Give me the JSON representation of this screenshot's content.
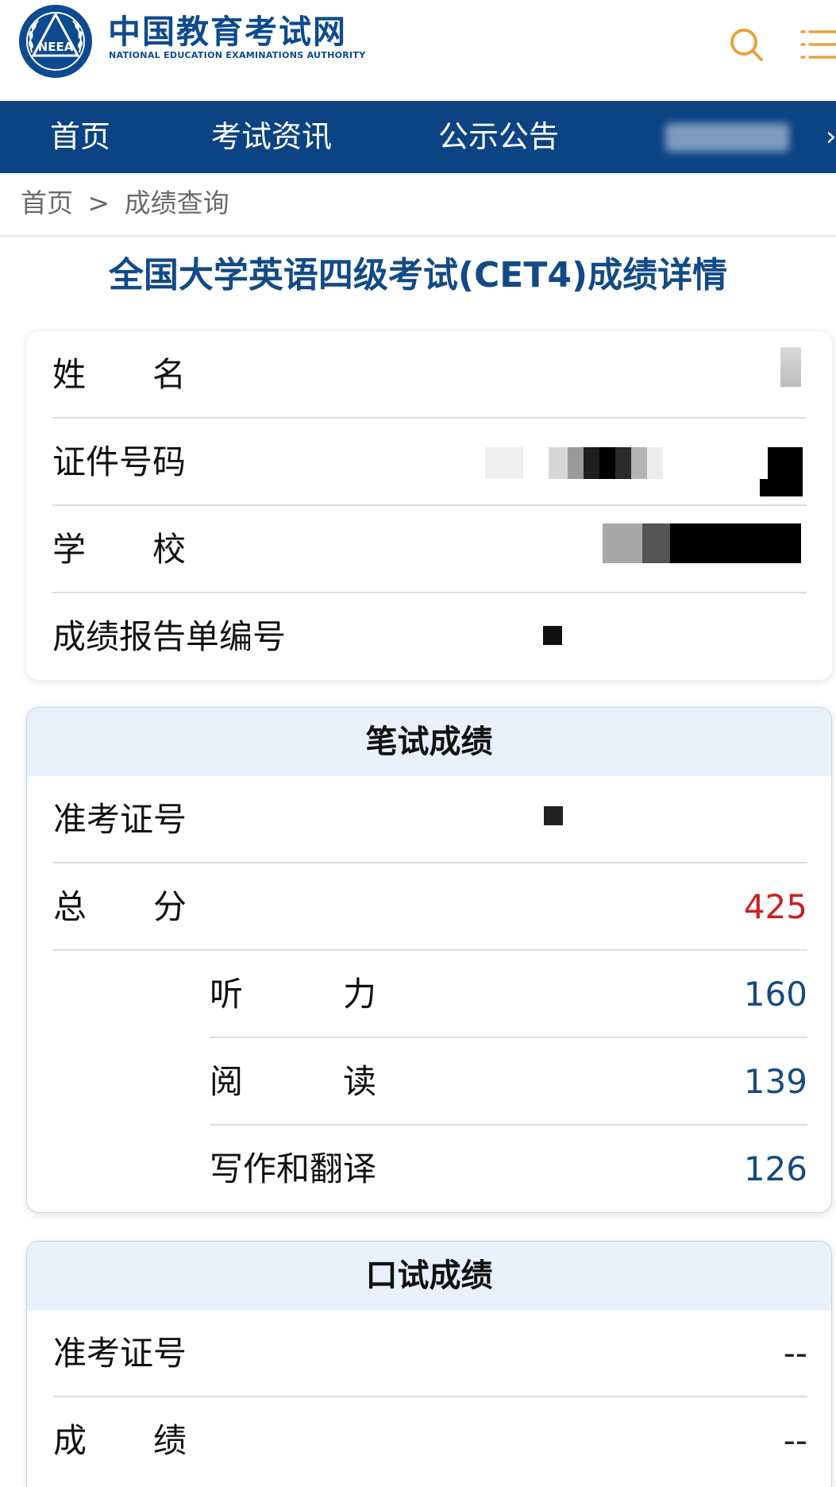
{
  "header": {
    "logo_initials": "NEEA",
    "brand_cn": "中国教育考试网",
    "brand_en": "NATIONAL EDUCATION EXAMINATIONS AUTHORITY"
  },
  "nav": {
    "items": [
      "首页",
      "考试资讯",
      "公示公告"
    ],
    "more_glyph": "›"
  },
  "breadcrumb": {
    "home": "首页",
    "separator": ">",
    "current": "成绩查询"
  },
  "title": "全国大学英语四级考试(CET4)成绩详情",
  "info": {
    "rows": [
      {
        "label": "姓　　名"
      },
      {
        "label": "证件号码"
      },
      {
        "label": "学　　校"
      },
      {
        "label": "成绩报告单编号"
      }
    ]
  },
  "written": {
    "heading": "笔试成绩",
    "ticket_label": "准考证号",
    "total_label": "总　　分",
    "total_value": "425",
    "listening_label": "听　　　力",
    "listening_value": "160",
    "reading_label": "阅　　　读",
    "reading_value": "139",
    "writing_label": "写作和翻译",
    "writing_value": "126"
  },
  "oral": {
    "heading": "口试成绩",
    "ticket_label": "准考证号",
    "ticket_value": "--",
    "score_label": "成　　绩",
    "score_value": "--"
  },
  "colors": {
    "brand_blue": "#0c4383",
    "title_blue": "#124a86",
    "score_blue": "#164a82",
    "total_red": "#cc1f1f",
    "icon_orange": "#e8a33d"
  },
  "icons": {
    "search": "search-icon",
    "menu": "menu-icon",
    "emblem": "neea-emblem-icon"
  }
}
